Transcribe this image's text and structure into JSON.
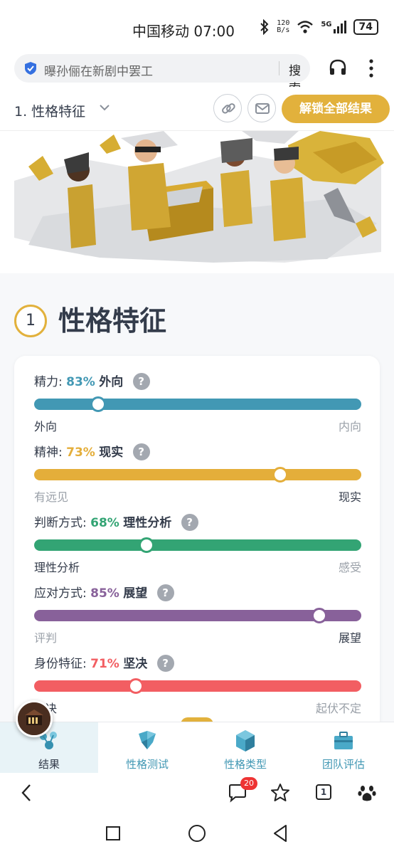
{
  "status_bar": {
    "carrier_time": "中国移动 07:00",
    "speed_top": "120",
    "speed_unit": "B/s",
    "network": "5G",
    "battery": "74"
  },
  "browser": {
    "search_text": "曝孙俪在新剧中罢工",
    "search_button": "搜索"
  },
  "header": {
    "title": "1. 性格特征",
    "unlock_button": "解锁全部结果"
  },
  "section": {
    "number": "1",
    "title": "性格特征"
  },
  "traits": [
    {
      "name": "精力:",
      "percent": "83%",
      "trait": "外向",
      "left_label": "外向",
      "right_label": "内向",
      "position": 0.195,
      "color": "#4298b4",
      "strong_side": "left"
    },
    {
      "name": "精神:",
      "percent": "73%",
      "trait": "现实",
      "left_label": "有远见",
      "right_label": "现实",
      "position": 0.753,
      "color": "#e4ae3a",
      "strong_side": "right"
    },
    {
      "name": "判断方式:",
      "percent": "68%",
      "trait": "理性分析",
      "left_label": "理性分析",
      "right_label": "感受",
      "position": 0.343,
      "color": "#33a474",
      "strong_side": "left"
    },
    {
      "name": "应对方式:",
      "percent": "85%",
      "trait": "展望",
      "left_label": "评判",
      "right_label": "展望",
      "position": 0.871,
      "color": "#88619a",
      "strong_side": "right"
    },
    {
      "name": "身份特征:",
      "percent": "71%",
      "trait": "坚决",
      "left_label": "坚决",
      "right_label": "起伏不定",
      "position": 0.311,
      "color": "#f25e62",
      "strong_side": "left"
    }
  ],
  "tabs": [
    {
      "label": "结果"
    },
    {
      "label": "性格测试"
    },
    {
      "label": "性格类型"
    },
    {
      "label": "团队评估"
    }
  ],
  "bottom_nav": {
    "comment_badge": "20",
    "tab_count": "1"
  }
}
